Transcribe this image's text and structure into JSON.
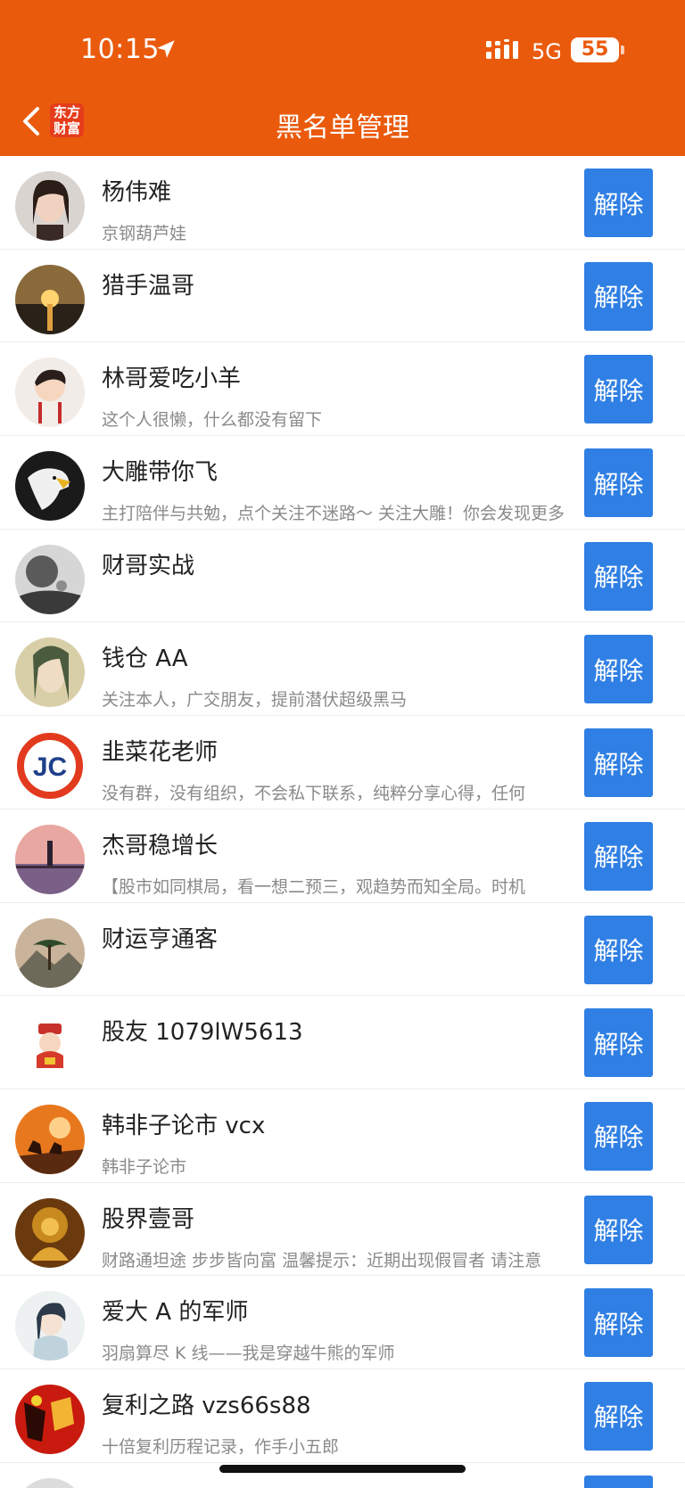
{
  "status_bar": {
    "time": "10:15",
    "network": "5G",
    "battery": "55"
  },
  "nav": {
    "logo_line1": "东方",
    "logo_line2": "财富",
    "title": "黑名单管理"
  },
  "colors": {
    "brand": "#ea5a0c",
    "button": "#2f7fe4"
  },
  "list": {
    "items": [
      {
        "name": "杨伟难",
        "desc": "京钢葫芦娃",
        "button": "解除",
        "avatar": "woman-portrait"
      },
      {
        "name": "猎手温哥",
        "desc": "",
        "button": "解除",
        "avatar": "sunset-sea"
      },
      {
        "name": "林哥爱吃小羊",
        "desc": "这个人很懒，什么都没有留下",
        "button": "解除",
        "avatar": "cartoon-boy"
      },
      {
        "name": "大雕带你飞",
        "desc": "主打陪伴与共勉，点个关注不迷路～ 关注大雕！你会发现更多",
        "button": "解除",
        "avatar": "eagle"
      },
      {
        "name": "财哥实战",
        "desc": "",
        "button": "解除",
        "avatar": "ink-landscape"
      },
      {
        "name": "钱仓 AA",
        "desc": "关注本人，广交朋友，提前潜伏超级黑马",
        "button": "解除",
        "avatar": "anime-face"
      },
      {
        "name": "韭菜花老师",
        "desc": "没有群，没有组织，不会私下联系，纯粹分享心得，任何",
        "button": "解除",
        "avatar": "jc-logo",
        "avatar_text": "JC"
      },
      {
        "name": "杰哥稳增长",
        "desc": "【股市如同棋局，看一想二预三，观趋势而知全局。时机",
        "button": "解除",
        "avatar": "lighthouse"
      },
      {
        "name": "财运亨通客",
        "desc": "",
        "button": "解除",
        "avatar": "pine-mountain"
      },
      {
        "name": "股友 1079lW5613",
        "desc": "",
        "button": "解除",
        "avatar": "fortune-god"
      },
      {
        "name": "韩非子论市 vcx",
        "desc": "韩非子论市",
        "button": "解除",
        "avatar": "horsemen-sunset"
      },
      {
        "name": "股界壹哥",
        "desc": "财路通坦途 步步皆向富 温馨提示：近期出现假冒者 请注意",
        "button": "解除",
        "avatar": "golden-buddha"
      },
      {
        "name": "爱大 A 的军师",
        "desc": "羽扇算尽 K 线——我是穿越牛熊的军师",
        "button": "解除",
        "avatar": "strategist"
      },
      {
        "name": "复利之路 vzs66s88",
        "desc": "十倍复利历程记录，作手小五郎",
        "button": "解除",
        "avatar": "red-warrior"
      },
      {
        "name": "",
        "desc": "",
        "button": "解除",
        "avatar": "partial"
      }
    ]
  }
}
